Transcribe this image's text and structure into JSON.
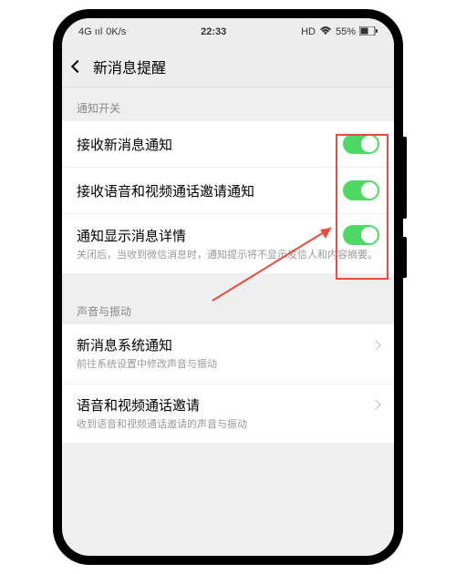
{
  "status": {
    "left_signal": "4G ııl",
    "left_speed": "0K/s",
    "time": "22:33",
    "right_hd": "HD",
    "right_battery": "55%"
  },
  "nav": {
    "title": "新消息提醒"
  },
  "sections": {
    "notify": {
      "header": "通知开关",
      "items": [
        {
          "title": "接收新消息通知"
        },
        {
          "title": "接收语音和视频通话邀请通知"
        },
        {
          "title": "通知显示消息详情",
          "sub": "关闭后，当收到微信消息时，通知提示将不显示发信人和内容摘要。"
        }
      ]
    },
    "sound": {
      "header": "声音与振动",
      "items": [
        {
          "title": "新消息系统通知",
          "sub": "前往系统设置中修改声音与振动"
        },
        {
          "title": "语音和视频通话邀请",
          "sub": "收到语音和视频通话邀请的声音与振动"
        }
      ]
    }
  }
}
